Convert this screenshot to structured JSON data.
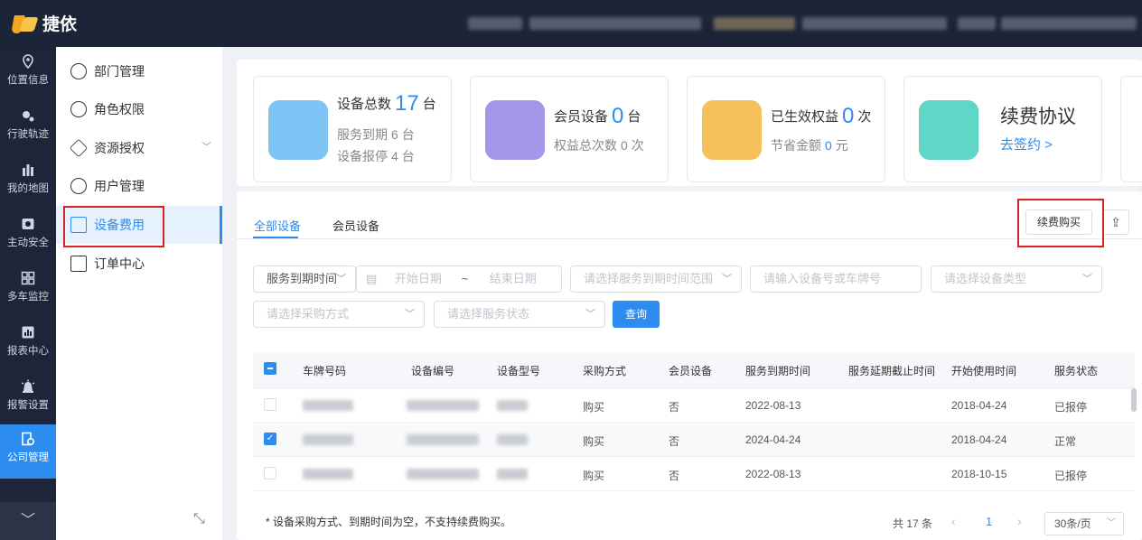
{
  "brand": {
    "name": "捷依"
  },
  "leftnav": {
    "items": [
      {
        "label": "位置信息",
        "icon": "location-icon"
      },
      {
        "label": "行驶轨迹",
        "icon": "track-icon"
      },
      {
        "label": "我的地图",
        "icon": "map-icon"
      },
      {
        "label": "主动安全",
        "icon": "safety-icon"
      },
      {
        "label": "多车监控",
        "icon": "grid-icon"
      },
      {
        "label": "报表中心",
        "icon": "report-icon"
      },
      {
        "label": "报警设置",
        "icon": "alarm-icon"
      },
      {
        "label": "公司管理",
        "icon": "company-icon",
        "active": true
      }
    ],
    "collapse": "﹀"
  },
  "submenu": {
    "items": [
      {
        "label": "部门管理"
      },
      {
        "label": "角色权限"
      },
      {
        "label": "资源授权"
      },
      {
        "label": "用户管理"
      },
      {
        "label": "设备费用",
        "active": true
      },
      {
        "label": "订单中心"
      }
    ]
  },
  "stats": {
    "device": {
      "label": "设备总数",
      "value": "17",
      "unit": "台",
      "expire_label": "服务到期",
      "expire_value": "6",
      "expire_unit": "台",
      "stop_label": "设备报停",
      "stop_value": "4",
      "stop_unit": "台"
    },
    "member": {
      "label": "会员设备",
      "value": "0",
      "unit": "台",
      "rights_label": "权益总次数",
      "rights_value": "0",
      "rights_unit": "次"
    },
    "effective": {
      "label": "已生效权益",
      "value": "0",
      "unit": "次",
      "saved_label": "节省金额",
      "saved_value": "0",
      "saved_unit": "元"
    },
    "renew": {
      "title": "续费协议",
      "link": "去签约 >"
    }
  },
  "tabs": [
    "全部设备",
    "会员设备"
  ],
  "toolbar": {
    "renew_button": "续费购买"
  },
  "filters": {
    "expire_type": "服务到期时间",
    "start_date": "开始日期",
    "tilde": "~",
    "end_date": "结束日期",
    "range": "请选择服务到期时间范围",
    "search": "请输入设备号或车牌号",
    "device_type": "请选择设备类型",
    "purchase": "请选择采购方式",
    "status": "请选择服务状态",
    "query": "查询"
  },
  "table": {
    "columns": [
      "车牌号码",
      "设备编号",
      "设备型号",
      "采购方式",
      "会员设备",
      "服务到期时间",
      "服务延期截止时间",
      "开始使用时间",
      "服务状态"
    ],
    "rows": [
      {
        "purchase": "购买",
        "member": "否",
        "expire": "2022-08-13",
        "ext": "",
        "start": "2018-04-24",
        "status": "已报停",
        "checked": false
      },
      {
        "purchase": "购买",
        "member": "否",
        "expire": "2024-04-24",
        "ext": "",
        "start": "2018-04-24",
        "status": "正常",
        "checked": true
      },
      {
        "purchase": "购买",
        "member": "否",
        "expire": "2022-08-13",
        "ext": "",
        "start": "2018-10-15",
        "status": "已报停",
        "checked": false
      }
    ]
  },
  "footer": {
    "note": "* 设备采购方式、到期时间为空，不支持续费购买。",
    "total": "共 17 条",
    "prev": "‹",
    "current_page": "1",
    "next": "›",
    "page_size": "30条/页"
  },
  "colors": {
    "accent": "#2d8cf0",
    "nav_bg": "#1e2539",
    "highlight_box": "#d92323"
  }
}
